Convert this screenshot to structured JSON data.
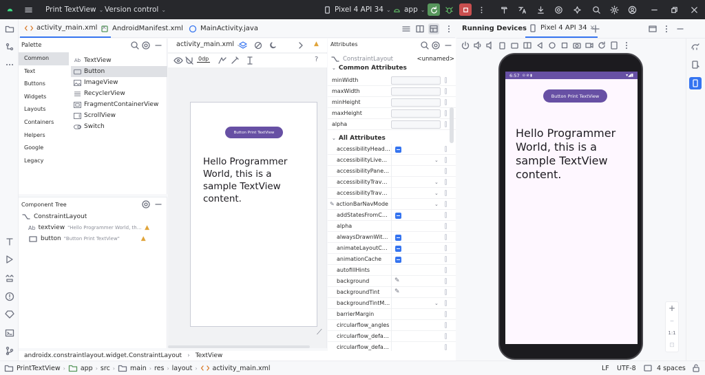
{
  "titlebar": {
    "project": "Print TextView",
    "vcs": "Version control",
    "device": "Pixel 4 API 34",
    "config": "app"
  },
  "tabs": [
    {
      "label": "activity_main.xml"
    },
    {
      "label": "AndroidManifest.xml"
    },
    {
      "label": "MainActivity.java"
    }
  ],
  "palette": {
    "title": "Palette",
    "categories": [
      "Common",
      "Text",
      "Buttons",
      "Widgets",
      "Layouts",
      "Containers",
      "Helpers",
      "Google",
      "Legacy"
    ],
    "widgets": [
      {
        "label": "TextView",
        "icon": "Ab"
      },
      {
        "label": "Button",
        "icon": "button-icon"
      },
      {
        "label": "ImageView",
        "icon": "image-icon"
      },
      {
        "label": "RecyclerView",
        "icon": "list-icon"
      },
      {
        "label": "FragmentContainerView",
        "icon": "fragment-icon"
      },
      {
        "label": "ScrollView",
        "icon": "scroll-icon"
      },
      {
        "label": "Switch",
        "icon": "switch-icon"
      }
    ]
  },
  "component_tree": {
    "title": "Component Tree",
    "root": "ConstraintLayout",
    "items": [
      {
        "type_icon": "Ab",
        "name": "textview",
        "detail": "\"Hello Programmer World, this is ..."
      },
      {
        "type_icon": "button-icon",
        "name": "button",
        "detail": "\"Button Print TextView\""
      }
    ]
  },
  "design": {
    "file_select": "activity_main.xml",
    "margin": "0dp",
    "canvas_button": "Button Print TextView",
    "canvas_text": "Hello Programmer World, this is a sample TextView content."
  },
  "attributes": {
    "title": "Attributes",
    "component": "ConstraintLayout",
    "component_id": "<unnamed>",
    "common_header": "Common Attributes",
    "common": [
      "minWidth",
      "maxWidth",
      "minHeight",
      "maxHeight",
      "alpha"
    ],
    "all_header": "All Attributes",
    "all": [
      {
        "name": "accessibilityHeading",
        "kind": "check"
      },
      {
        "name": "accessibilityLiveRegi...",
        "kind": "dropdown"
      },
      {
        "name": "accessibilityPaneTitle",
        "kind": "none"
      },
      {
        "name": "accessibilityTravers...",
        "kind": "dropdown"
      },
      {
        "name": "accessibilityTravers...",
        "kind": "dropdown"
      },
      {
        "name": "actionBarNavMode",
        "kind": "dropdown"
      },
      {
        "name": "addStatesFromChild...",
        "kind": "check"
      },
      {
        "name": "alpha",
        "kind": "none"
      },
      {
        "name": "alwaysDrawnWithCa...",
        "kind": "check"
      },
      {
        "name": "animateLayoutChan...",
        "kind": "check"
      },
      {
        "name": "animationCache",
        "kind": "check"
      },
      {
        "name": "autofillHints",
        "kind": "none"
      },
      {
        "name": "background",
        "kind": "picker"
      },
      {
        "name": "backgroundTint",
        "kind": "picker"
      },
      {
        "name": "backgroundTintMode",
        "kind": "dropdown"
      },
      {
        "name": "barrierMargin",
        "kind": "none"
      },
      {
        "name": "circularflow_angles",
        "kind": "none"
      },
      {
        "name": "circularflow_defaultA...",
        "kind": "none"
      },
      {
        "name": "circularflow_defaultR...",
        "kind": "none"
      }
    ]
  },
  "running_devices": {
    "title": "Running Devices",
    "device_tab": "Pixel 4 API 34",
    "status_time": "6:57",
    "button": "Button Print TextView",
    "text": "Hello Programmer World, this is a sample TextView content.",
    "zoom_label": "1:1"
  },
  "breadcrumb": [
    "androidx.constraintlayout.widget.ConstraintLayout",
    "TextView"
  ],
  "statusbar": {
    "path": [
      "PrintTextView",
      "app",
      "src",
      "main",
      "res",
      "layout",
      "activity_main.xml"
    ],
    "line_sep": "LF",
    "encoding": "UTF-8",
    "indent": "4 spaces"
  },
  "colors": {
    "accent": "#3574f0",
    "primary": "#6750a4",
    "run": "#57965c",
    "stop": "#c94f4f",
    "warning": "#e0a43a"
  }
}
